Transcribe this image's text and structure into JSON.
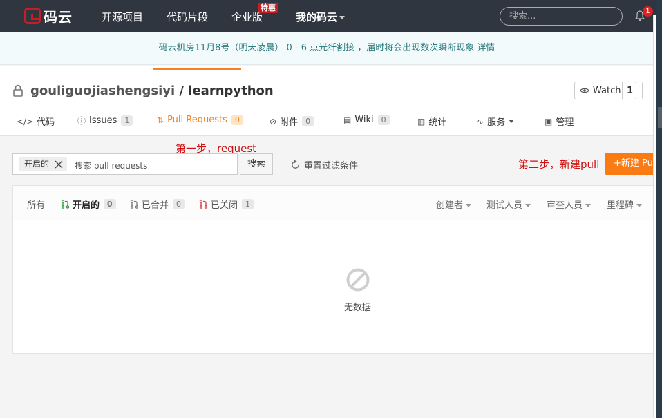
{
  "nav": {
    "logo_text": "码云",
    "links": [
      "开源项目",
      "代码片段",
      "企业版",
      "我的码云"
    ],
    "badge": "特惠",
    "search_placeholder": "搜索...",
    "notification_count": "1"
  },
  "notice": "码云机房11月8号（明天凌晨） 0 - 6 点光纤割接 ，届时将会出现数次瞬断现象 详情",
  "repo": {
    "owner": "gouliguojiashengsiyi",
    "separator": " / ",
    "name": "learnpython",
    "watch_label": "Watch",
    "watch_count": "1"
  },
  "tabs": [
    {
      "icon": "</>",
      "label": "代码",
      "count": ""
    },
    {
      "icon": "ⓘ",
      "label": "Issues",
      "count": "1"
    },
    {
      "icon": "⇅",
      "label": "Pull Requests",
      "count": "0"
    },
    {
      "icon": "⊘",
      "label": "附件",
      "count": "0"
    },
    {
      "icon": "▤",
      "label": "Wiki",
      "count": "0"
    },
    {
      "icon": "▥",
      "label": "统计",
      "count": ""
    },
    {
      "icon": "∿",
      "label": "服务",
      "count": ""
    },
    {
      "icon": "▣",
      "label": "管理",
      "count": ""
    }
  ],
  "annotations": {
    "step1": "第一步，request",
    "step2": "第二步，新建pull"
  },
  "filter": {
    "chip": "开启的",
    "placeholder": "搜索 pull requests",
    "search_button": "搜索",
    "reset": "重置过滤条件",
    "new_pull": "+新建 Pull"
  },
  "list": {
    "states": [
      {
        "label": "所有",
        "count": ""
      },
      {
        "label": "开启的",
        "count": "0"
      },
      {
        "label": "已合并",
        "count": "0"
      },
      {
        "label": "已关闭",
        "count": "1"
      }
    ],
    "filters": [
      "创建者",
      "测试人员",
      "审查人员",
      "里程碑"
    ],
    "empty_text": "无数据"
  },
  "colors": {
    "nav_bg": "#2f3640",
    "accent": "#f58220",
    "new_button": "#fa7a14",
    "annotation": "#d01010"
  }
}
